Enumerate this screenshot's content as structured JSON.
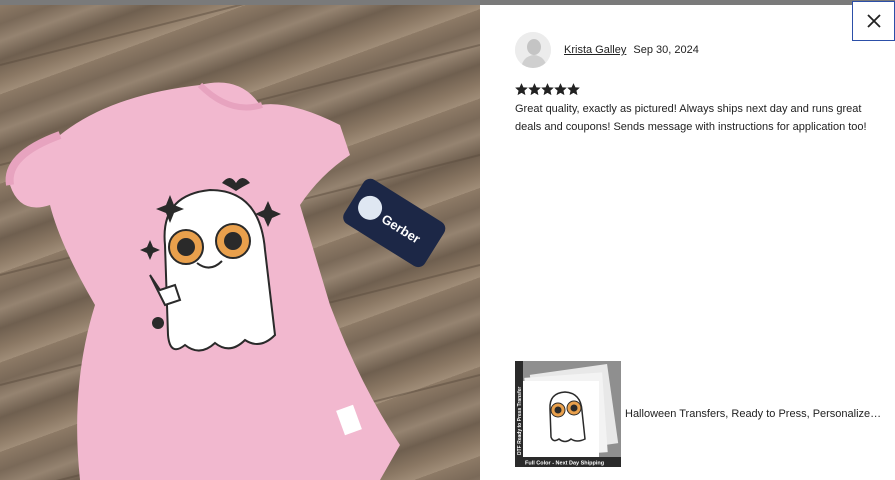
{
  "modal": {
    "close_icon": "close-icon"
  },
  "photo": {
    "description_icon": "product-photo",
    "tag_brand": "Gerber",
    "label_brand": "Gerber"
  },
  "review": {
    "reviewer_name": "Krista Galley",
    "date": "Sep 30, 2024",
    "rating": 5,
    "rating_max": 5,
    "text": "Great quality, exactly as pictured! Always ships next day and runs great deals and coupons! Sends message with instructions for application too!"
  },
  "listing": {
    "title": "Halloween Transfers, Ready to Press, Personalized …",
    "thumb_banner": "Full Color - Next Day Shipping",
    "thumb_side_text": "DTF Ready to Press Transfer"
  },
  "colors": {
    "accent_focus": "#2c4fa8",
    "star": "#222222",
    "onesie_pink": "#f2b8cf"
  }
}
